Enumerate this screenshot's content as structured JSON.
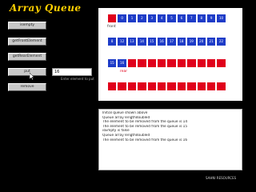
{
  "app": {
    "title": "Array Queue"
  },
  "buttons": [
    {
      "label": "isempty"
    },
    {
      "label": "getFrontElement"
    },
    {
      "label": "getRearElement"
    },
    {
      "label": "put"
    },
    {
      "label": "remove"
    }
  ],
  "input": {
    "value": "16",
    "caption": "Enter element to put"
  },
  "queue": {
    "rows": [
      {
        "cells": [
          "",
          "0",
          "1",
          "2",
          "3",
          "4",
          "5",
          "6",
          "7",
          "8",
          "9",
          "10"
        ],
        "colors": [
          "#e0001b",
          "#1e3cc8",
          "#1e3cc8",
          "#1e3cc8",
          "#1e3cc8",
          "#1e3cc8",
          "#1e3cc8",
          "#1e3cc8",
          "#1e3cc8",
          "#1e3cc8",
          "#1e3cc8",
          "#1e3cc8"
        ],
        "label": "front"
      },
      {
        "cells": [
          "8",
          "12",
          "13",
          "14",
          "15",
          "16",
          "17",
          "18",
          "19",
          "20",
          "21",
          "22"
        ],
        "colors": [
          "#1e3cc8",
          "#1e3cc8",
          "#1e3cc8",
          "#1e3cc8",
          "#1e3cc8",
          "#1e3cc8",
          "#1e3cc8",
          "#1e3cc8",
          "#1e3cc8",
          "#1e3cc8",
          "#1e3cc8",
          "#1e3cc8"
        ],
        "label": ""
      },
      {
        "cells": [
          "15",
          "16",
          "",
          "",
          "",
          "",
          "",
          "",
          "",
          "",
          "",
          ""
        ],
        "colors": [
          "#1e3cc8",
          "#1e3cc8",
          "#e0001b",
          "#e0001b",
          "#e0001b",
          "#e0001b",
          "#e0001b",
          "#e0001b",
          "#e0001b",
          "#e0001b",
          "#e0001b",
          "#e0001b"
        ],
        "label": "rear"
      },
      {
        "cells": [
          "",
          "",
          "",
          "",
          "",
          "",
          "",
          "",
          "",
          "",
          "",
          ""
        ],
        "colors": [
          "#e0001b",
          "#e0001b",
          "#e0001b",
          "#e0001b",
          "#e0001b",
          "#e0001b",
          "#e0001b",
          "#e0001b",
          "#e0001b",
          "#e0001b",
          "#e0001b",
          "#e0001b"
        ],
        "label": ""
      }
    ]
  },
  "log": [
    "Initial queue shown above",
    "Queue array lengthdoubled",
    "The element to be removed from the queue is 14",
    "The element to be removed from the queue is 15",
    "isEmpty is false",
    "Queue array lengthdoubled",
    "The element to be removed from the queue is 16"
  ],
  "footer": "SAHNI RESOURCES"
}
